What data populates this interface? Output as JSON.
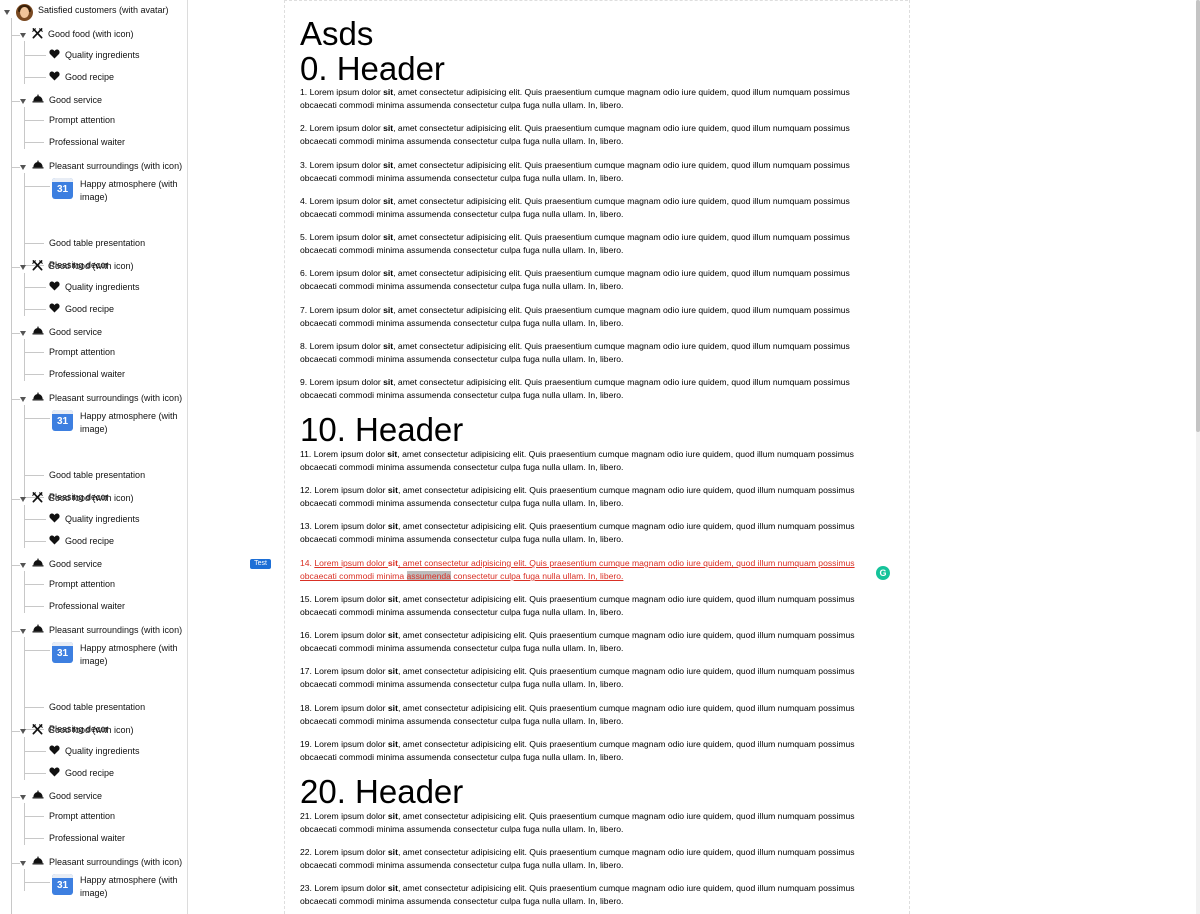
{
  "tree": {
    "root_label": "Satisfied customers (with avatar)",
    "groups": [
      {
        "food": {
          "label": "Good food (with icon)",
          "items": [
            "Quality ingredients",
            "Good recipe"
          ]
        },
        "service": {
          "label": "Good service",
          "items": [
            "Prompt attention",
            "Professional waiter"
          ]
        },
        "surroundings": {
          "label": "Pleasant surroundings (with icon)",
          "image_item": "Happy atmosphere (with image)",
          "items": [
            "Good table presentation",
            "Pleasing decor"
          ]
        }
      },
      {
        "food": {
          "label": "Good food (with icon)",
          "items": [
            "Quality ingredients",
            "Good recipe"
          ]
        },
        "service": {
          "label": "Good service",
          "items": [
            "Prompt attention",
            "Professional waiter"
          ]
        },
        "surroundings": {
          "label": "Pleasant surroundings (with icon)",
          "image_item": "Happy atmosphere (with image)",
          "items": [
            "Good table presentation",
            "Pleasing decor"
          ]
        }
      },
      {
        "food": {
          "label": "Good food (with icon)",
          "items": [
            "Quality ingredients",
            "Good recipe"
          ]
        },
        "service": {
          "label": "Good service",
          "items": [
            "Prompt attention",
            "Professional waiter"
          ]
        },
        "surroundings": {
          "label": "Pleasant surroundings (with icon)",
          "image_item": "Happy atmosphere (with image)",
          "items": [
            "Good table presentation",
            "Pleasing decor"
          ]
        }
      },
      {
        "food": {
          "label": "Good food (with icon)",
          "items": [
            "Quality ingredients",
            "Good recipe"
          ]
        },
        "service": {
          "label": "Good service",
          "items": [
            "Prompt attention",
            "Professional waiter"
          ]
        },
        "surroundings": {
          "label": "Pleasant surroundings (with icon)",
          "image_item": "Happy atmosphere (with image)",
          "items": []
        }
      }
    ],
    "calendar_day": "31",
    "icons": {
      "root": "avatar-icon",
      "food": "fork-knife-icon",
      "food_item": "heart-icon",
      "service": "service-bell-icon",
      "image": "calendar-icon"
    }
  },
  "document": {
    "title": "Asds",
    "headers": [
      "0. Header",
      "10. Header",
      "20. Header"
    ],
    "paragraph_text": {
      "before_bold": "Lorem ipsum dolor ",
      "bold": "sit",
      "line1_after": ", amet consectetur adipisicing elit. Quis praesentium cumque magnam odio iure quidem, quod illum numquam possimus",
      "line2": "obcaecati commodi minima assumenda consectetur culpa fuga nulla ullam. In, libero."
    },
    "paragraph_numbers": [
      "1.",
      "2.",
      "3.",
      "4.",
      "5.",
      "6.",
      "7.",
      "8.",
      "9.",
      "11.",
      "12.",
      "13.",
      "14.",
      "15.",
      "16.",
      "17.",
      "18.",
      "19.",
      "21.",
      "22.",
      "23."
    ],
    "error_paragraph_number": "14.",
    "highlighted_word": "assumenda",
    "badge_label": "Test",
    "grammarly_label": "G"
  },
  "colors": {
    "error_text": "#d93025",
    "badge_bg": "#1d6fd6",
    "grammarly": "#15c39a",
    "calendar": "#3d7fe0"
  }
}
